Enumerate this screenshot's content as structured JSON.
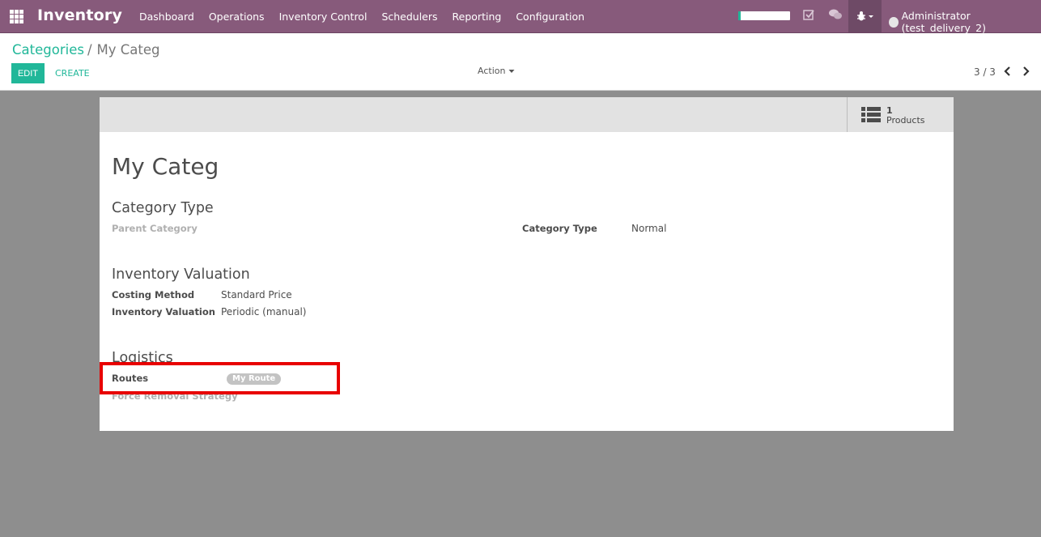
{
  "app": {
    "name": "Inventory"
  },
  "menu": [
    "Dashboard",
    "Operations",
    "Inventory Control",
    "Schedulers",
    "Reporting",
    "Configuration"
  ],
  "progress_fraction": 0.05,
  "user": {
    "label": "Administrator (test_delivery_2)"
  },
  "breadcrumb": {
    "parent": "Categories",
    "separator": "/",
    "current": "My Categ"
  },
  "buttons": {
    "edit": "EDIT",
    "create": "CREATE",
    "action": "Action"
  },
  "pager": {
    "text": "3 / 3"
  },
  "smart_button": {
    "value": "1",
    "label": "Products"
  },
  "record": {
    "title": "My Categ",
    "sections": {
      "category_type": {
        "heading": "Category Type",
        "parent_category_label": "Parent Category",
        "category_type_label": "Category Type",
        "category_type_value": "Normal"
      },
      "inventory_valuation": {
        "heading": "Inventory Valuation",
        "costing_method_label": "Costing Method",
        "costing_method_value": "Standard Price",
        "valuation_label": "Inventory Valuation",
        "valuation_value": "Periodic (manual)"
      },
      "logistics": {
        "heading": "Logistics",
        "routes_label": "Routes",
        "routes_tag": "My Route",
        "removal_label": "Force Removal Strategy"
      }
    }
  },
  "colors": {
    "brand": "#875a7b",
    "accent": "#21b799",
    "highlight": "#e80000"
  }
}
